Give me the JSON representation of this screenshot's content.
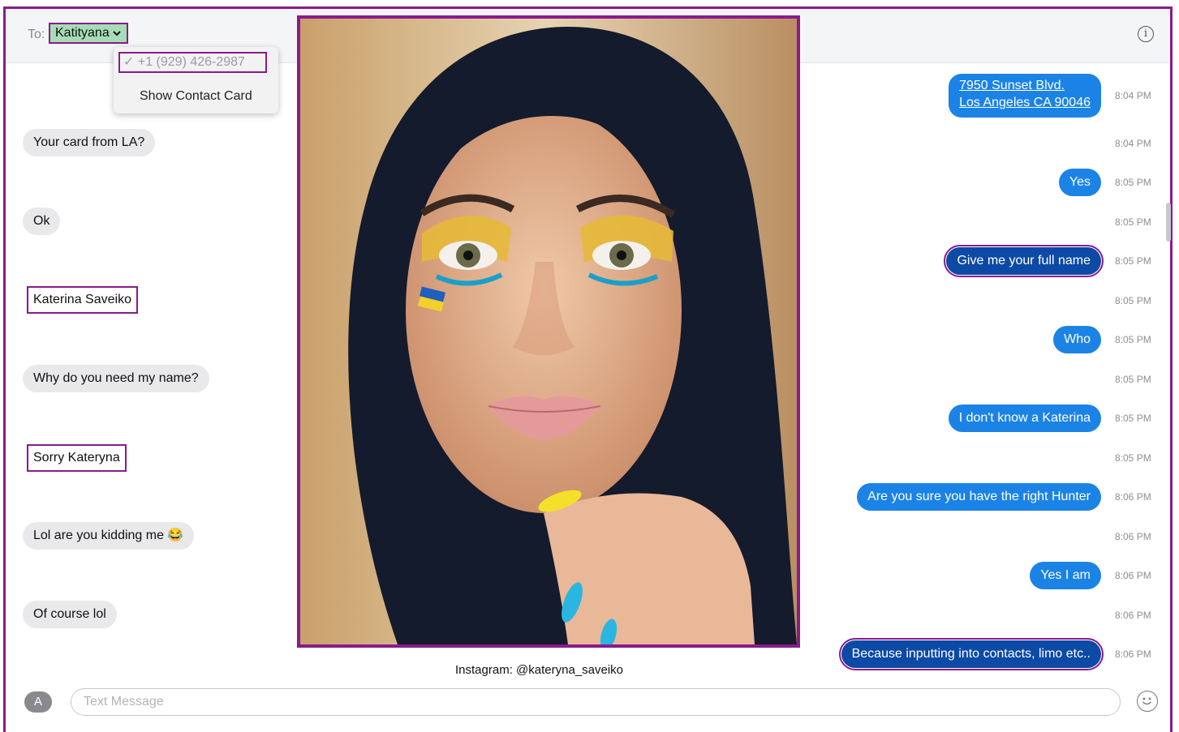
{
  "header": {
    "to_label": "To:",
    "recipient": "Katityana",
    "popup_phone": "✓ +1 (929) 426-2987",
    "popup_action": "Show Contact Card"
  },
  "messages_left": [
    "Your card from LA?",
    "Ok",
    "Katerina Saveiko",
    "Why do you need my name?",
    "Sorry Kateryna",
    "Lol are you kidding me 😂",
    "Of course lol"
  ],
  "messages_right": [
    "7950 Sunset Blvd.\nLos Angeles CA 90046",
    "Yes",
    "Give me your full name",
    "Who",
    "I don't know a Katerina",
    "Are you sure you have the right Hunter",
    "Yes I am",
    "Because inputting into contacts, limo etc.."
  ],
  "timestamps": [
    "8:04 PM",
    "8:04 PM",
    "8:05 PM",
    "8:05 PM",
    "8:05 PM",
    "8:05 PM",
    "8:05 PM",
    "8:05 PM",
    "8:05 PM",
    "8:05 PM",
    "8:06 PM",
    "8:06 PM",
    "8:06 PM",
    "8:06 PM",
    "8:06 PM"
  ],
  "caption": "Instagram: @kateryna_saveiko",
  "composer": {
    "placeholder": "Text Message"
  },
  "icons": {
    "info": "info-icon",
    "appstore": "appstore-icon",
    "emoji": "emoji-icon",
    "chevron": "chevron-down-icon"
  },
  "colors": {
    "highlight": "#8b1a8c",
    "sent_bubble": "#1c83e6",
    "received_bubble": "#e9e9eb",
    "recipient_fill": "#a6dcb6"
  }
}
